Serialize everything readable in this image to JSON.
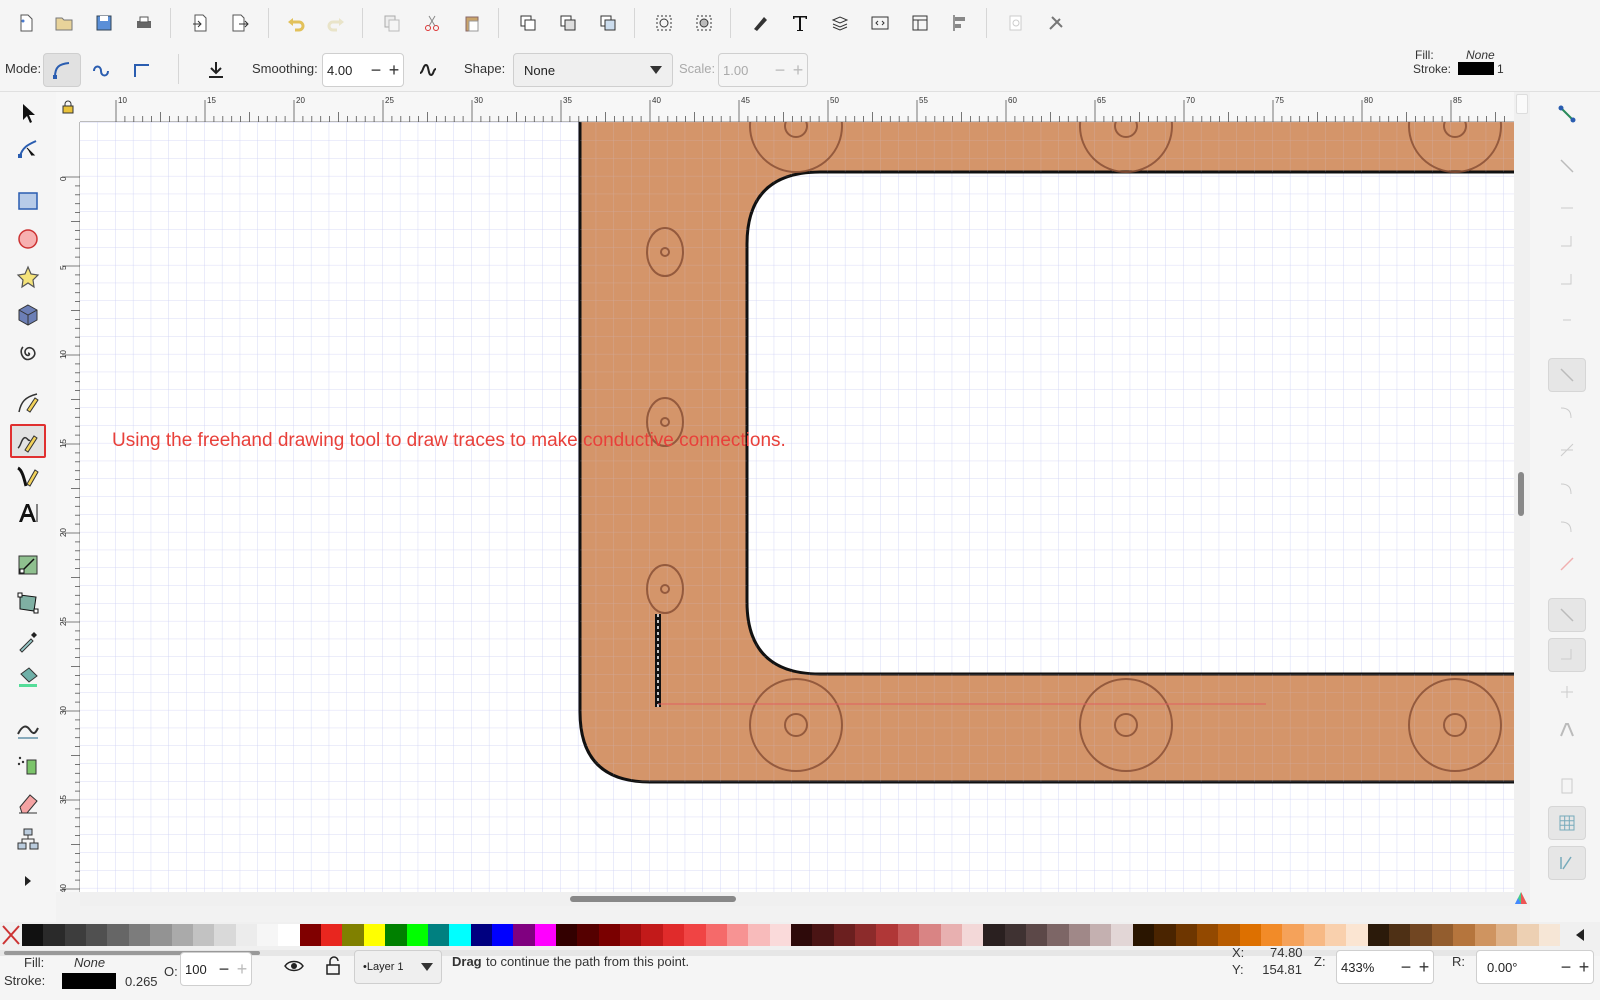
{
  "command_bar": {
    "icons": [
      "new-document-icon",
      "open-file-icon",
      "save-icon",
      "print-icon",
      "import-icon",
      "export-icon",
      "undo-icon",
      "redo-icon",
      "copy-icon",
      "cut-icon",
      "paste-icon",
      "duplicate-icon",
      "clone-icon",
      "unlink-clone-icon",
      "zoom-selection-icon",
      "zoom-drawing-icon",
      "fill-stroke-icon",
      "text-font-icon",
      "layers-icon",
      "xml-editor-icon",
      "document-properties-icon",
      "align-distribute-icon",
      "find-icon",
      "preferences-icon"
    ]
  },
  "tool_controls": {
    "mode_label": "Mode:",
    "smoothing_label": "Smoothing:",
    "smoothing_value": "4.00",
    "shape_label": "Shape:",
    "shape_value": "None",
    "scale_label": "Scale:",
    "scale_value": "1.00",
    "fill_label": "Fill:",
    "fill_value": "None",
    "stroke_label": "Stroke:",
    "stroke_width": "1",
    "stroke_color": "#000000"
  },
  "toolbox": {
    "tools": [
      "selector-tool",
      "node-tool",
      "rectangle-tool",
      "ellipse-tool",
      "star-tool",
      "3d-box-tool",
      "spiral-tool",
      "pen-tool",
      "pencil-tool",
      "calligraphy-tool",
      "text-tool",
      "gradient-tool",
      "mesh-tool",
      "dropper-tool",
      "paint-bucket-tool",
      "tweak-tool",
      "spray-tool",
      "eraser-tool",
      "connector-tool"
    ],
    "selected": "pencil-tool"
  },
  "ruler": {
    "h_labels": [
      "10",
      "15",
      "20",
      "25",
      "30",
      "35",
      "40",
      "45",
      "50",
      "55",
      "60",
      "65",
      "70",
      "75",
      "80",
      "85"
    ],
    "v_labels": [
      "0",
      "5",
      "10",
      "15",
      "20",
      "25",
      "30",
      "35",
      "40"
    ]
  },
  "canvas": {
    "annotation": "Using the freehand drawing tool to draw traces to make conductive connections.",
    "annotation_color": "#e8403a",
    "board_color": "#d4956a",
    "grid_color": "#c9cdf2"
  },
  "palette": {
    "colors": [
      "#111111",
      "#2a2a2a",
      "#3d3d3d",
      "#505050",
      "#666666",
      "#7c7c7c",
      "#939393",
      "#aaaaaa",
      "#c2c2c2",
      "#d9d9d9",
      "#ececec",
      "#f6f6f6",
      "#ffffff",
      "#800000",
      "#e8261f",
      "#808000",
      "#ffff00",
      "#008000",
      "#00ff00",
      "#008080",
      "#00ffff",
      "#000080",
      "#0000ff",
      "#800080",
      "#ff00ff",
      "#330000",
      "#550000",
      "#7a0000",
      "#a00d0d",
      "#c21a1a",
      "#e02b2b",
      "#f04444",
      "#f56a6a",
      "#f79393",
      "#f8bbbb",
      "#fadada",
      "#2e0a0a",
      "#4a1414",
      "#6b1f1f",
      "#8c2b2b",
      "#b03737",
      "#c85a5a",
      "#d98484",
      "#e8b0b0",
      "#f3d8d8",
      "#2a2020",
      "#3f3232",
      "#5c4848",
      "#7d6666",
      "#a08888",
      "#c4b0b0",
      "#e2d6d6",
      "#2a1500",
      "#4a2400",
      "#6e3600",
      "#934900",
      "#b85c00",
      "#dd7000",
      "#f28b28",
      "#f5a25a",
      "#f7b985",
      "#f9d0ad",
      "#fbe5d2",
      "#2b1a0a",
      "#4e3015",
      "#714622",
      "#935d2e",
      "#b5753d",
      "#cf9460",
      "#dfb289",
      "#edd0b3",
      "#f6e6d6"
    ]
  },
  "status_bar": {
    "fill_label": "Fill:",
    "fill_value": "None",
    "stroke_label": "Stroke:",
    "stroke_width": "0.265",
    "opacity_label": "O:",
    "opacity_value": "100",
    "layer_label": "•Layer 1",
    "hint_bold": "Drag",
    "hint_rest": " to continue the path from this point.",
    "x_label": "X:",
    "x_value": "74.80",
    "y_label": "Y:",
    "y_value": "154.81",
    "zoom_label": "Z:",
    "zoom_value": "433%",
    "rotation_label": "R:",
    "rotation_value": "0.00°"
  }
}
